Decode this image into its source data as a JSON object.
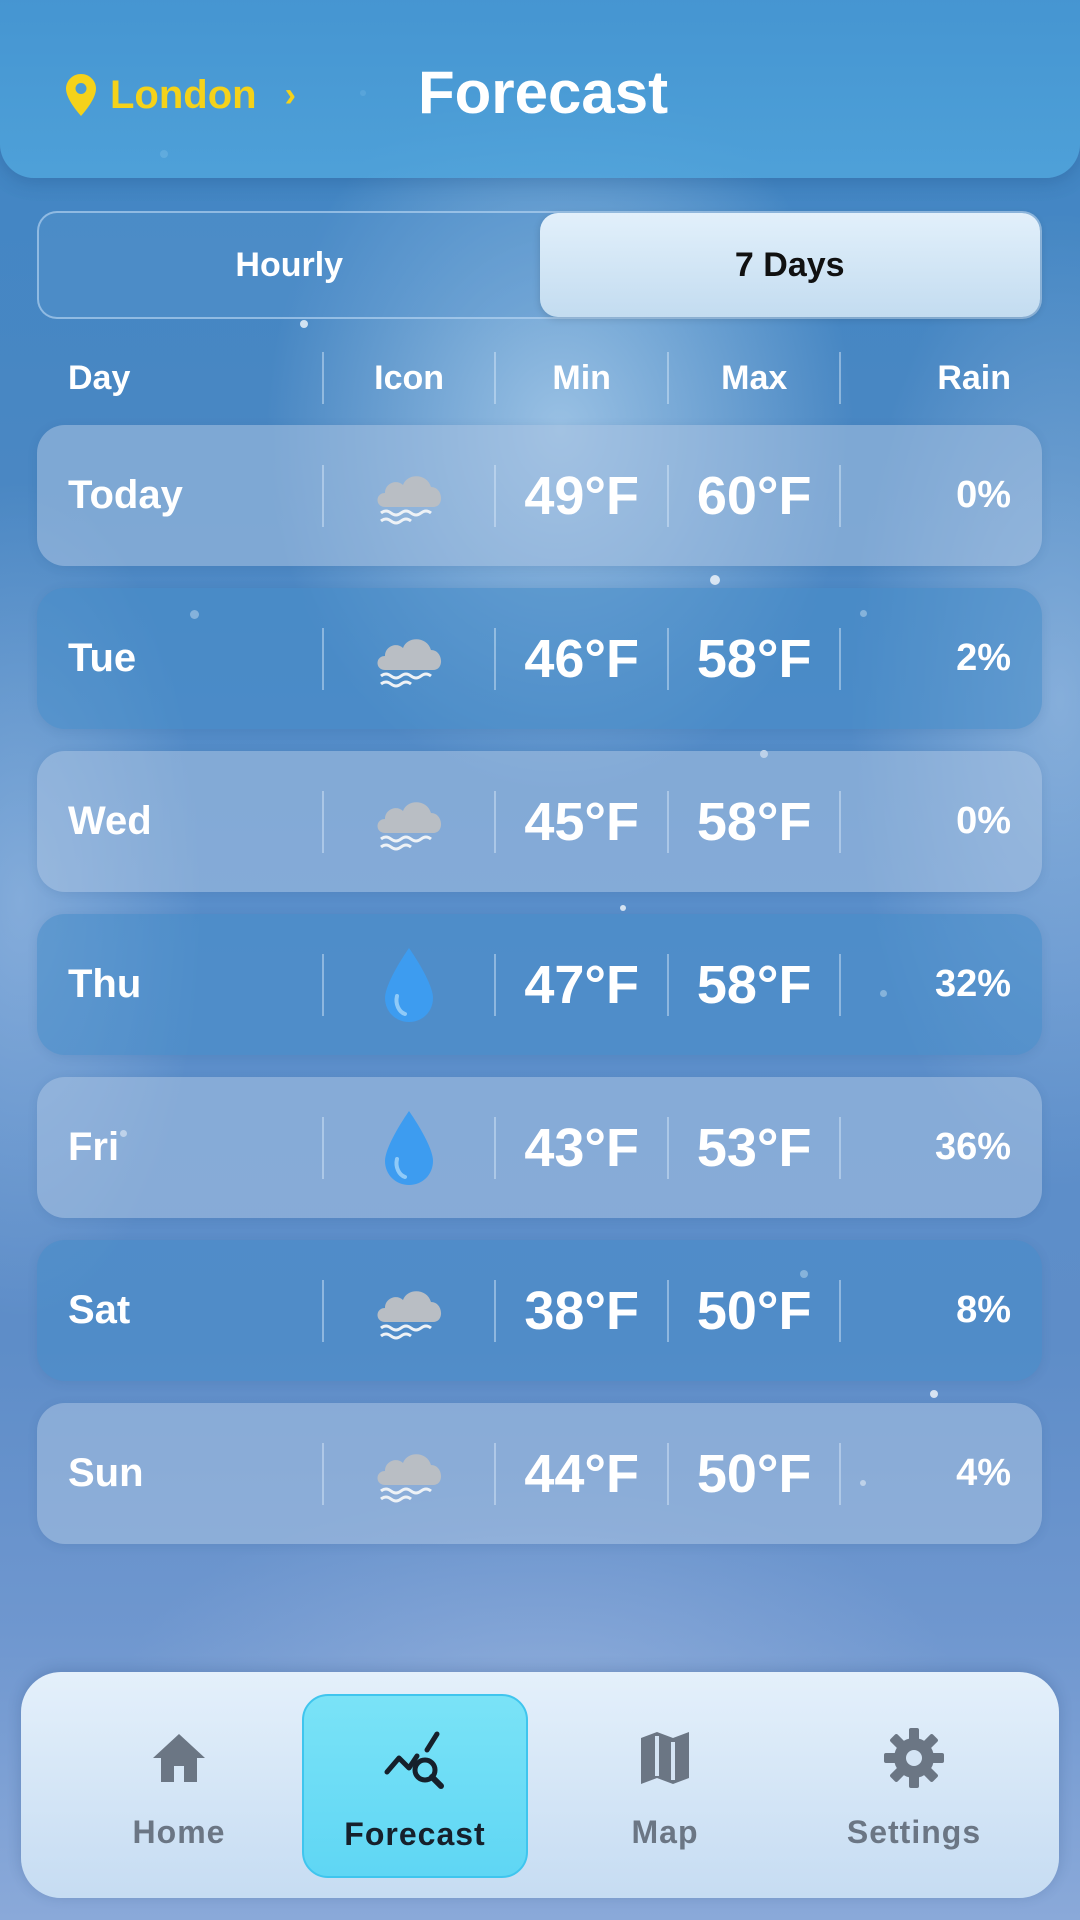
{
  "header": {
    "location": "London",
    "title": "Forecast"
  },
  "tabs": [
    {
      "label": "Hourly",
      "active": false
    },
    {
      "label": "7 Days",
      "active": true
    }
  ],
  "table": {
    "headers": {
      "day": "Day",
      "icon": "Icon",
      "min": "Min",
      "max": "Max",
      "rain": "Rain"
    },
    "rows": [
      {
        "day": "Today",
        "icon": "fog-cloud-icon",
        "min": "49°F",
        "max": "60°F",
        "rain": "0%"
      },
      {
        "day": "Tue",
        "icon": "fog-cloud-icon",
        "min": "46°F",
        "max": "58°F",
        "rain": "2%"
      },
      {
        "day": "Wed",
        "icon": "fog-cloud-icon",
        "min": "45°F",
        "max": "58°F",
        "rain": "0%"
      },
      {
        "day": "Thu",
        "icon": "rain-drop-icon",
        "min": "47°F",
        "max": "58°F",
        "rain": "32%"
      },
      {
        "day": "Fri",
        "icon": "rain-drop-icon",
        "min": "43°F",
        "max": "53°F",
        "rain": "36%"
      },
      {
        "day": "Sat",
        "icon": "fog-cloud-icon",
        "min": "38°F",
        "max": "50°F",
        "rain": "8%"
      },
      {
        "day": "Sun",
        "icon": "fog-cloud-icon",
        "min": "44°F",
        "max": "50°F",
        "rain": "4%"
      }
    ]
  },
  "nav": {
    "items": [
      {
        "label": "Home",
        "icon": "home-icon",
        "active": false
      },
      {
        "label": "Forecast",
        "icon": "chart-search-icon",
        "active": true
      },
      {
        "label": "Map",
        "icon": "map-icon",
        "active": false
      },
      {
        "label": "Settings",
        "icon": "gear-icon",
        "active": false
      }
    ]
  },
  "colors": {
    "accent_location": "#f5d21a",
    "active_nav": "#6ddcf6",
    "drop_blue": "#3d9cf0"
  }
}
